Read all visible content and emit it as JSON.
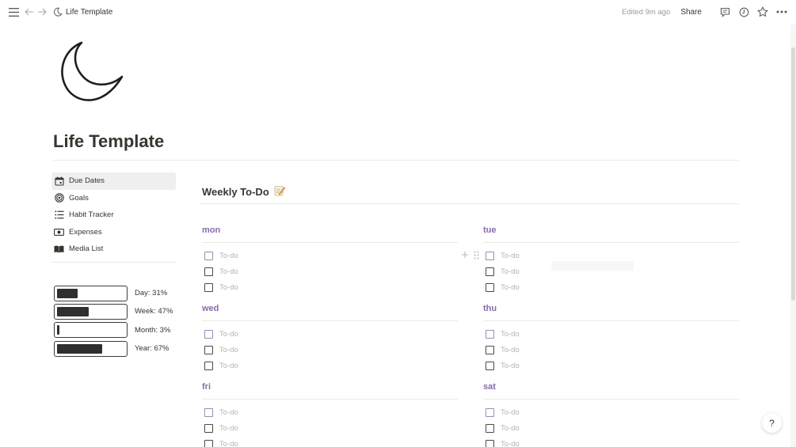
{
  "topbar": {
    "breadcrumb_title": "Life Template",
    "edited": "Edited 9m ago",
    "share_label": "Share"
  },
  "page": {
    "title": "Life Template",
    "icon": "crescent-moon-icon"
  },
  "nav": {
    "items": [
      {
        "label": "Due Dates",
        "icon": "calendar-icon",
        "active": true
      },
      {
        "label": "Goals",
        "icon": "target-icon",
        "active": false
      },
      {
        "label": "Habit Tracker",
        "icon": "list-icon",
        "active": false
      },
      {
        "label": "Expenses",
        "icon": "cash-icon",
        "active": false
      },
      {
        "label": "Media List",
        "icon": "book-icon",
        "active": false
      }
    ]
  },
  "progress": [
    {
      "label": "Day: 31%",
      "value": 31
    },
    {
      "label": "Week: 47%",
      "value": 47
    },
    {
      "label": "Month: 3%",
      "value": 3
    },
    {
      "label": "Year: 67%",
      "value": 67
    }
  ],
  "weekly": {
    "title": "Weekly To-Do",
    "emoji": "memo-icon"
  },
  "days": [
    {
      "name": "mon",
      "todos": [
        "To-do",
        "To-do",
        "To-do"
      ]
    },
    {
      "name": "tue",
      "todos": [
        "To-do",
        "To-do",
        "To-do"
      ]
    },
    {
      "name": "wed",
      "todos": [
        "To-do",
        "To-do",
        "To-do"
      ]
    },
    {
      "name": "thu",
      "todos": [
        "To-do",
        "To-do",
        "To-do"
      ]
    },
    {
      "name": "fri",
      "todos": [
        "To-do",
        "To-do",
        "To-do"
      ]
    },
    {
      "name": "sat",
      "todos": [
        "To-do",
        "To-do",
        "To-do"
      ]
    }
  ],
  "help_label": "?",
  "colors": {
    "accent_purple": "#8a6ba8",
    "text": "#37352f",
    "muted": "#b4b3b0",
    "bar_fill": "#2f2f2f"
  }
}
